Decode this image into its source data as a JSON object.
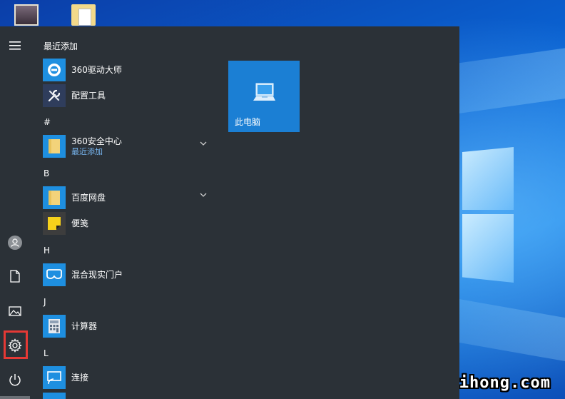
{
  "start_menu": {
    "rail": {
      "hamburger_icon": "hamburger-icon",
      "user_icon": "user-icon",
      "documents_icon": "document-icon",
      "pictures_icon": "picture-icon",
      "settings_icon": "gear-icon",
      "power_icon": "power-icon"
    },
    "recently_added_header": "最近添加",
    "recent": [
      {
        "name": "360驱动大师",
        "icon": "360-driver-icon",
        "tile_color": "#1e8fe0"
      },
      {
        "name": "配置工具",
        "icon": "wrench-icon",
        "tile_color": "#2f3d5c"
      }
    ],
    "groups": [
      {
        "letter": "#",
        "items": [
          {
            "name": "360安全中心",
            "sub": "最近添加",
            "icon": "folder-icon",
            "tile_color": "#1e8fe0",
            "expandable": true
          }
        ]
      },
      {
        "letter": "B",
        "items": [
          {
            "name": "百度网盘",
            "icon": "folder-icon",
            "tile_color": "#1e8fe0",
            "expandable": true
          },
          {
            "name": "便笺",
            "icon": "sticky-notes-icon",
            "tile_color": "#3d3d3d",
            "expandable": false
          }
        ]
      },
      {
        "letter": "H",
        "items": [
          {
            "name": "混合现实门户",
            "icon": "mixed-reality-icon",
            "tile_color": "#1e8fe0",
            "expandable": false
          }
        ]
      },
      {
        "letter": "J",
        "items": [
          {
            "name": "计算器",
            "icon": "calculator-icon",
            "tile_color": "#1e8fe0",
            "expandable": false
          }
        ]
      },
      {
        "letter": "L",
        "items": [
          {
            "name": "连接",
            "icon": "connect-icon",
            "tile_color": "#1e8fe0",
            "expandable": false
          }
        ]
      }
    ],
    "tiles": [
      {
        "label": "此电脑",
        "icon": "computer-icon",
        "color": "#1b7fd4"
      }
    ],
    "highlight_color": "#e53935"
  },
  "desktop": {
    "watermark": "hubeihong.com"
  }
}
